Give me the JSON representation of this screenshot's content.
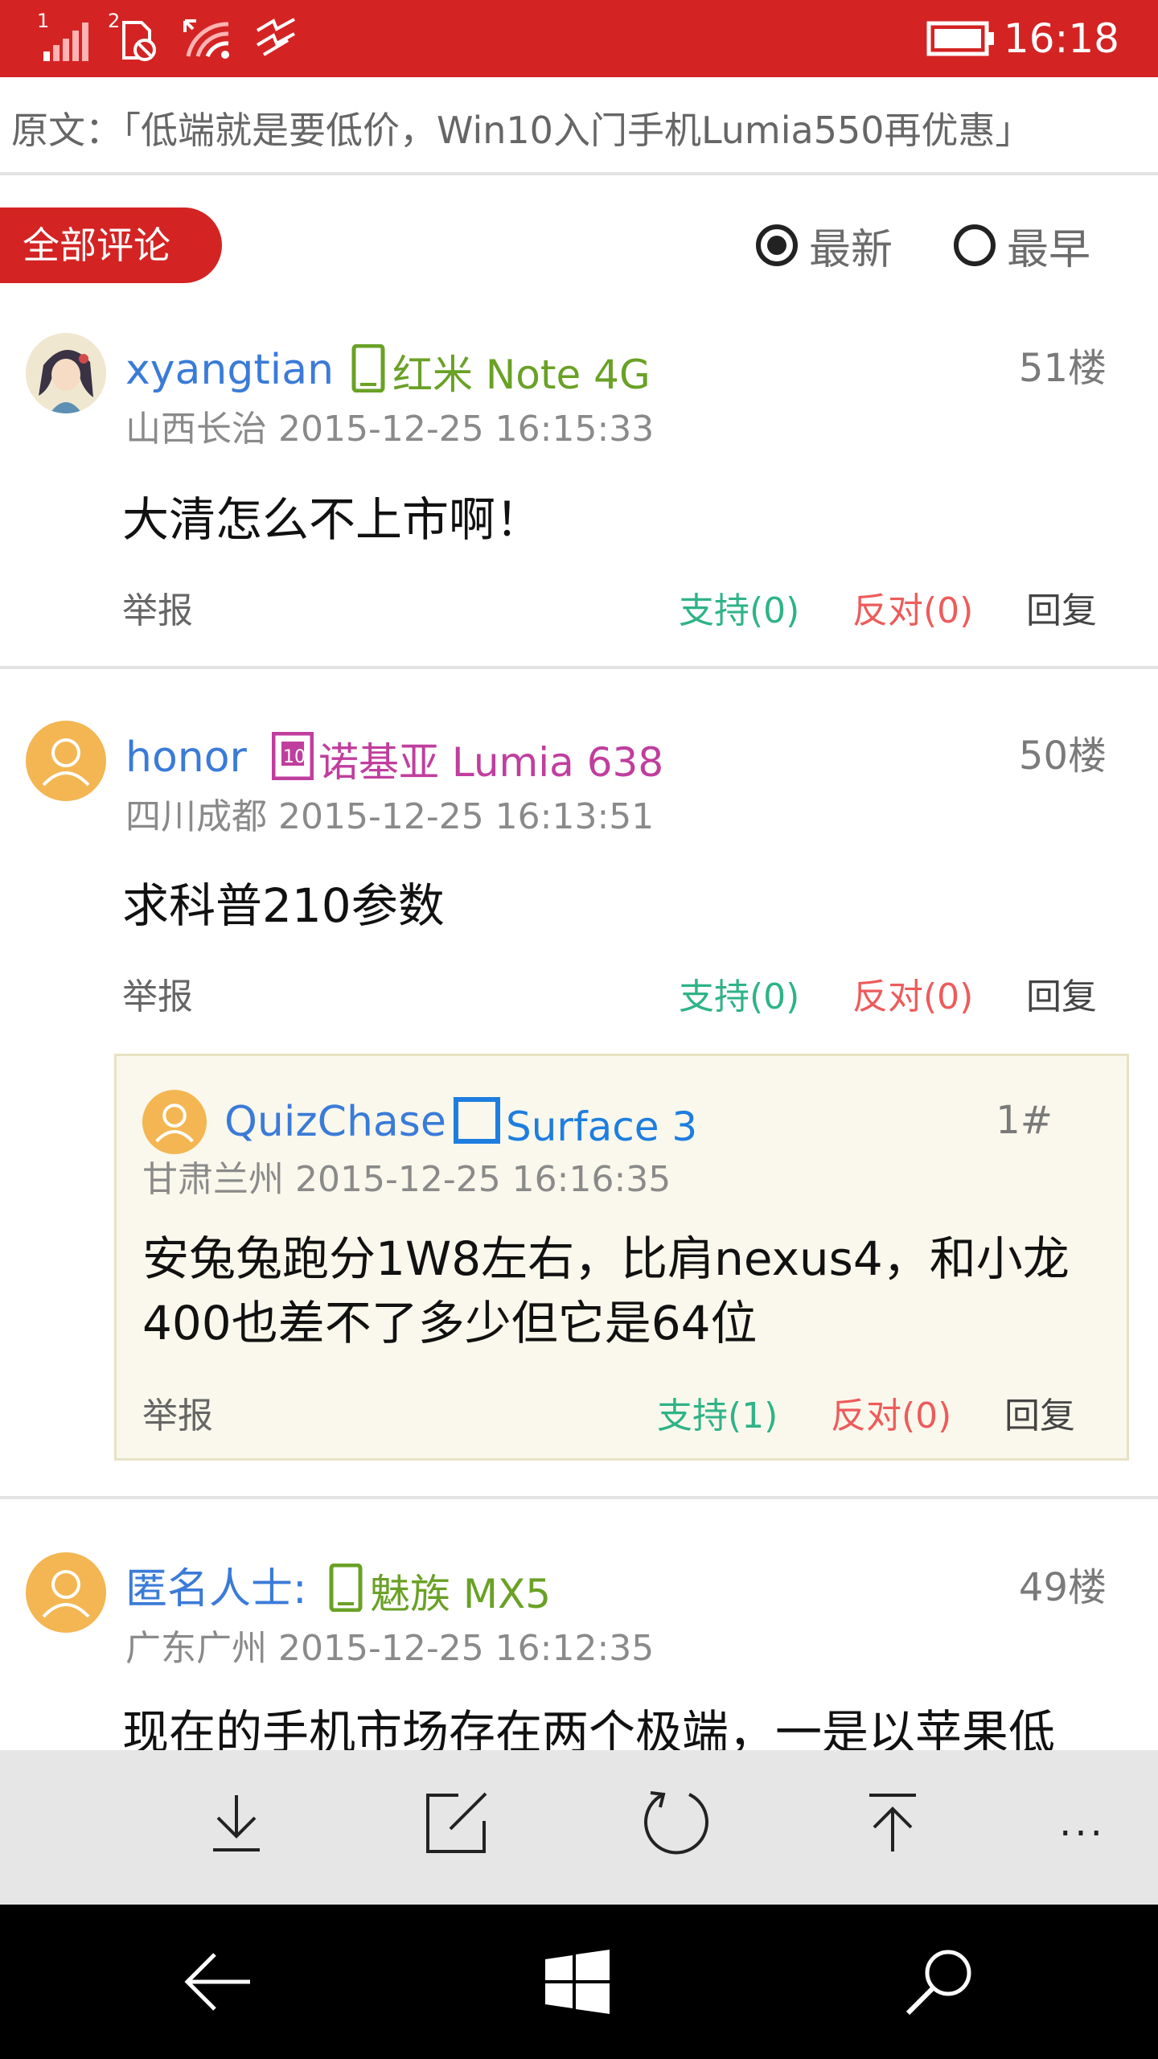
{
  "status_bar": {
    "time": "16:18",
    "sim1_label": "1",
    "sim2_label": "2",
    "icons": [
      "signal-bars-icon",
      "sim2-no-service-icon",
      "wifi-icon",
      "data-sense-icon",
      "battery-icon"
    ]
  },
  "article": {
    "source_text": "原文：「低端就是要低价，Win10入门手机Lumia550再优惠」"
  },
  "tabs": {
    "all_comments": "全部评论",
    "sort_options": [
      {
        "label": "最新",
        "selected": true
      },
      {
        "label": "最早",
        "selected": false
      }
    ]
  },
  "comments": [
    {
      "username": "xyangtian",
      "device": "红米 Note 4G",
      "device_icon": "phone-icon",
      "device_color": "#6aa126",
      "floor": "51楼",
      "location_time": "山西长治 2015-12-25 16:15:33",
      "text": "大清怎么不上市啊！",
      "actions": {
        "report": "举报",
        "support": "支持(0)",
        "oppose": "反对(0)",
        "reply": "回复"
      }
    },
    {
      "username": "honor",
      "device": "诺基亚 Lumia 638",
      "device_icon": "windows-phone-icon",
      "device_color": "#c03e9e",
      "floor": "50楼",
      "location_time": "四川成都 2015-12-25 16:13:51",
      "text": "求科普210参数",
      "actions": {
        "report": "举报",
        "support": "支持(0)",
        "oppose": "反对(0)",
        "reply": "回复"
      },
      "replies": [
        {
          "username": "QuizChase",
          "device": "Surface 3",
          "device_icon": "tablet-icon",
          "device_color": "#1e7ee0",
          "floor": "1#",
          "location_time": "甘肃兰州 2015-12-25 16:16:35",
          "text_lines": [
            "安兔兔跑分1W8左右，比肩nexus4，和小龙",
            "400也差不了多少但它是64位"
          ],
          "actions": {
            "report": "举报",
            "support": "支持(1)",
            "oppose": "反对(0)",
            "reply": "回复"
          }
        }
      ]
    },
    {
      "username": "匿名人士:",
      "device": "魅族 MX5",
      "device_icon": "phone-icon",
      "device_color": "#6aa126",
      "floor": "49楼",
      "location_time": "广东广州 2015-12-25 16:12:35",
      "text": "现在的手机市场存在两个极端，一是以苹果低"
    }
  ],
  "app_bar": {
    "buttons": [
      "download-icon",
      "compose-icon",
      "refresh-icon",
      "scroll-top-icon"
    ],
    "more": "..."
  },
  "nav_bar": {
    "buttons": [
      "back-icon",
      "windows-start-icon",
      "search-icon"
    ]
  },
  "colors": {
    "accent": "#d42323",
    "username": "#3b7bd8",
    "support": "#2fb387",
    "oppose": "#ee5b5b",
    "reply_bg": "#faf8ec"
  }
}
